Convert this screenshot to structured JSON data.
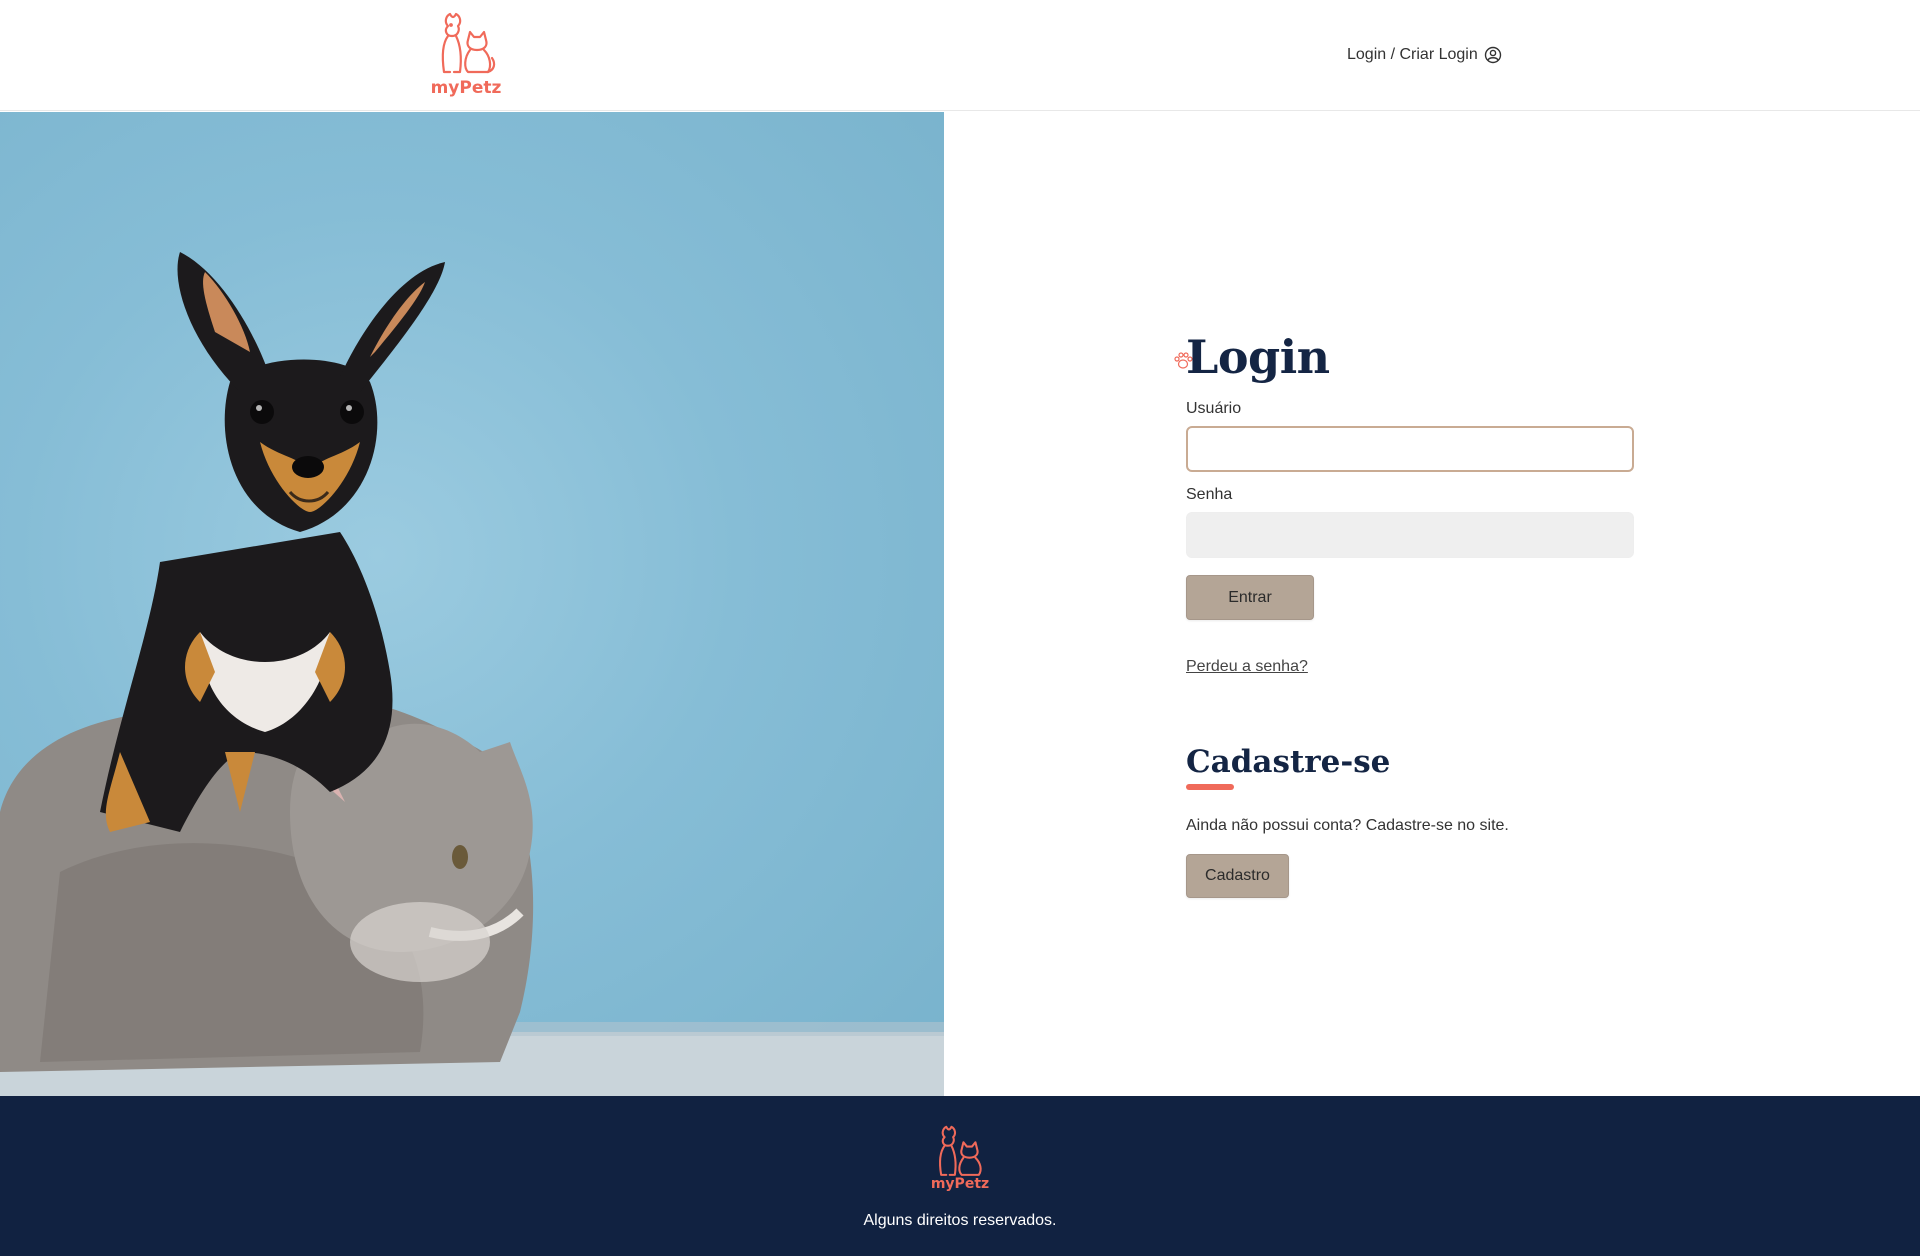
{
  "header": {
    "logo_text": "myPetz",
    "login_link": "Login / Criar Login"
  },
  "login": {
    "title": "Login",
    "username_label": "Usuário",
    "username_value": "",
    "password_label": "Senha",
    "password_value": "",
    "submit_label": "Entrar",
    "forgot_link": "Perdeu a senha?"
  },
  "register": {
    "title": "Cadastre-se",
    "text": "Ainda não possui conta? Cadastre-se no site.",
    "button_label": "Cadastro"
  },
  "footer": {
    "logo_text": "myPetz",
    "copyright": "Alguns direitos reservados."
  },
  "colors": {
    "brand": "#f06a5a",
    "navy": "#112241",
    "button": "#b4a596",
    "photo_bg": "#86bdd6"
  },
  "icons": {
    "user": "user-circle-icon",
    "paw": "paw-icon",
    "logo": "dog-cat-logo-icon"
  }
}
